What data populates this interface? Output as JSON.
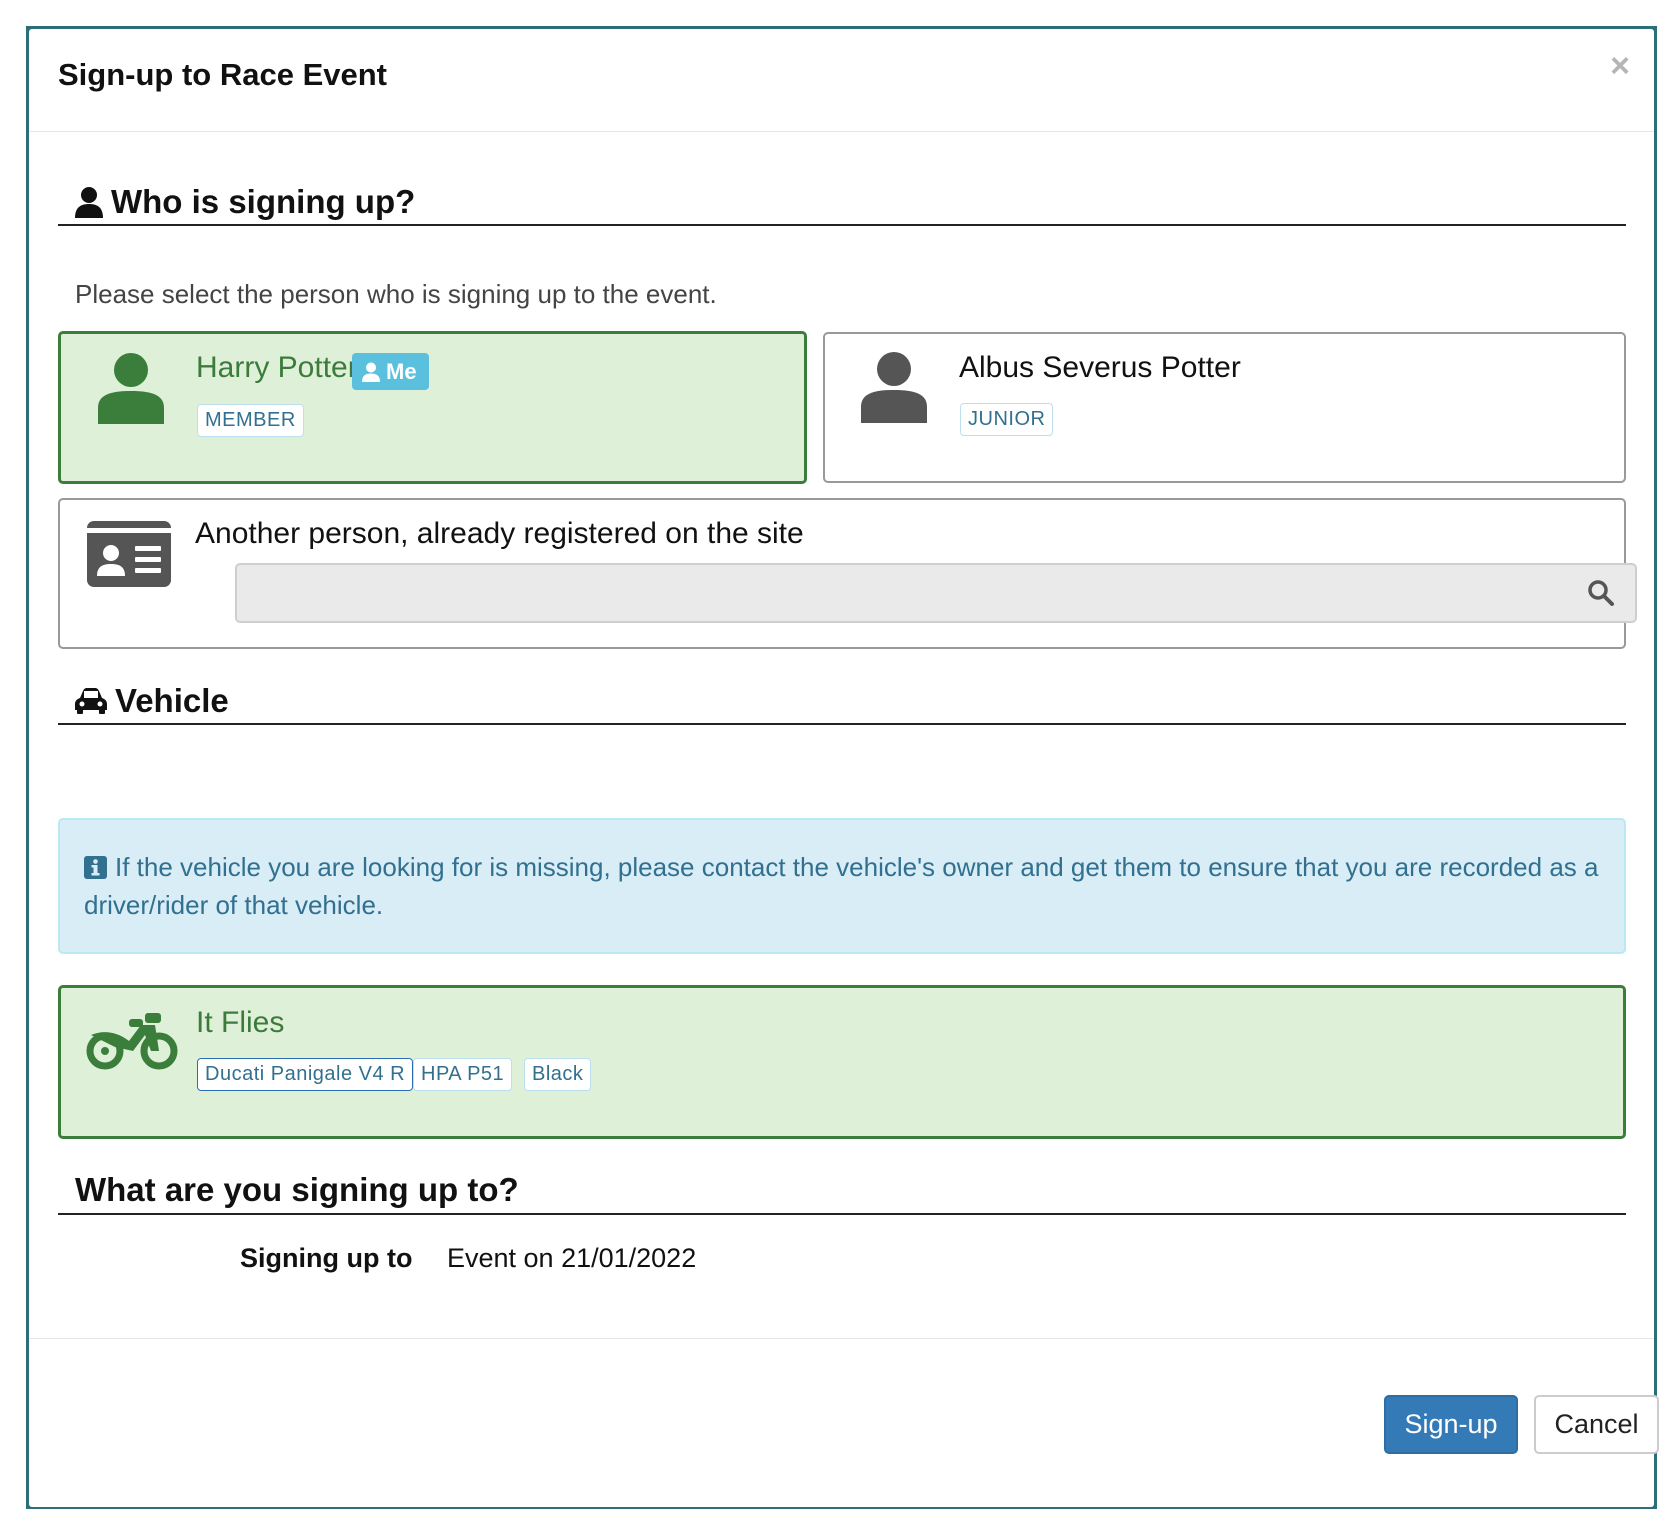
{
  "modal": {
    "title": "Sign-up to Race Event",
    "close_label": "×"
  },
  "who_section": {
    "heading": "Who is signing up?",
    "help_text": "Please select the person who is signing up to the event.",
    "people": [
      {
        "name": "Harry Potter",
        "me_badge": "Me",
        "tag": "MEMBER",
        "selected": true
      },
      {
        "name": "Albus Severus Potter",
        "tag": "JUNIOR",
        "selected": false
      }
    ],
    "another_person": {
      "label": "Another person, already registered on the site",
      "search_value": "",
      "search_placeholder": ""
    }
  },
  "vehicle_section": {
    "heading": "Vehicle",
    "info_text": "If the vehicle you are looking for is missing, please contact the vehicle's owner and get them to ensure that you are recorded as a driver/rider of that vehicle.",
    "vehicles": [
      {
        "name": "It Flies",
        "tags": [
          "Ducati Panigale V4 R",
          "HPA P51",
          "Black"
        ],
        "selected": true
      }
    ]
  },
  "signup_section": {
    "heading": "What are you signing up to?",
    "label": "Signing up to",
    "value": "Event on 21/01/2022"
  },
  "footer": {
    "primary_label": "Sign-up",
    "cancel_label": "Cancel"
  },
  "colors": {
    "selected_border": "#3b7d3b",
    "selected_bg": "#dff0d8",
    "info_bg": "#d9edf7",
    "info_text": "#31708f",
    "primary": "#337ab7",
    "me_badge": "#5bc0de"
  }
}
